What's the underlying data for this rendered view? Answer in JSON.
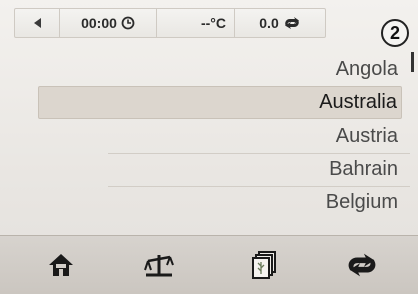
{
  "status_bar": {
    "time": "00:00",
    "temperature": "--°C",
    "consumption": "0.0"
  },
  "badge": "2",
  "countries": {
    "items": [
      "Angola",
      "Australia",
      "Austria",
      "Bahrain",
      "Belgium"
    ],
    "selected_index": 1
  },
  "icons": {
    "back": "back-arrow-icon",
    "clock": "clock-icon",
    "trip": "trip-loop-icon",
    "home": "home-icon",
    "scale": "scale-icon",
    "cards": "cards-icon",
    "route": "route-loop-icon"
  }
}
